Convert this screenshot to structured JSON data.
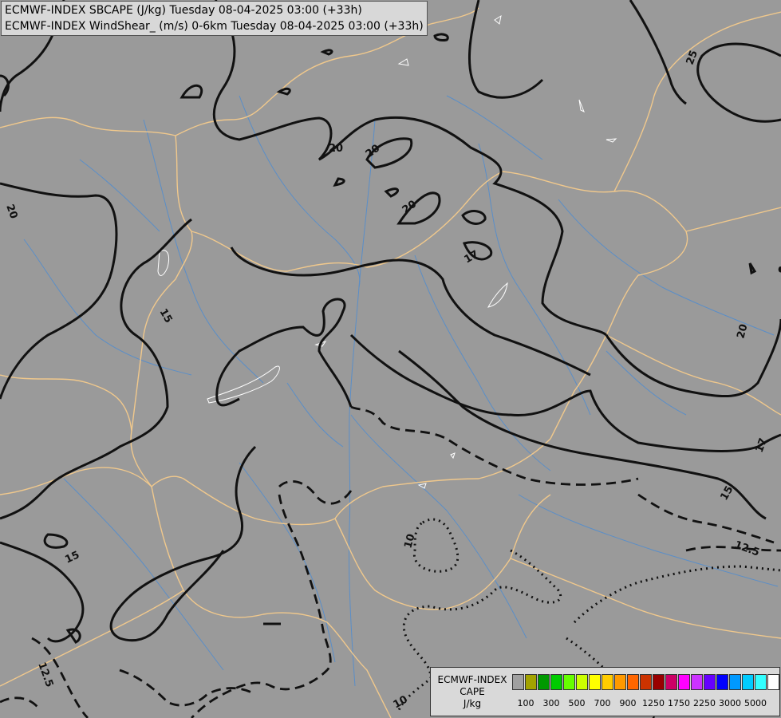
{
  "titles": [
    "ECMWF-INDEX SBCAPE (J/kg) Tuesday 08-04-2025 03:00 (+33h)",
    "ECMWF-INDEX WindShear_ (m/s) 0-6km Tuesday 08-04-2025 03:00 (+33h)"
  ],
  "contour_labels": [
    "20",
    "20",
    "20",
    "20",
    "17",
    "15",
    "15",
    "15",
    "12.5",
    "12.5",
    "10",
    "10",
    "25",
    "17",
    "20"
  ],
  "legend": {
    "title_lines": [
      "ECMWF-INDEX",
      "CAPE",
      "J/kg"
    ],
    "colors": [
      "#a0a0a0",
      "#a3a300",
      "#009900",
      "#00cc00",
      "#66ff00",
      "#ccff00",
      "#ffff00",
      "#ffcc00",
      "#ff9900",
      "#ff6600",
      "#cc3300",
      "#990000",
      "#cc0066",
      "#ff00ff",
      "#cc33ff",
      "#6600ff",
      "#0000ff",
      "#0099ff",
      "#00ccff",
      "#33ffff",
      "#ffffff"
    ],
    "ticks": [
      "100",
      "300",
      "500",
      "700",
      "900",
      "1250",
      "1750",
      "2250",
      "3000",
      "5000"
    ]
  },
  "colors": {
    "background": "#9a9a9a",
    "borders": "#f0c88c",
    "rivers": "#5a8ec8",
    "contours": "#111111"
  }
}
